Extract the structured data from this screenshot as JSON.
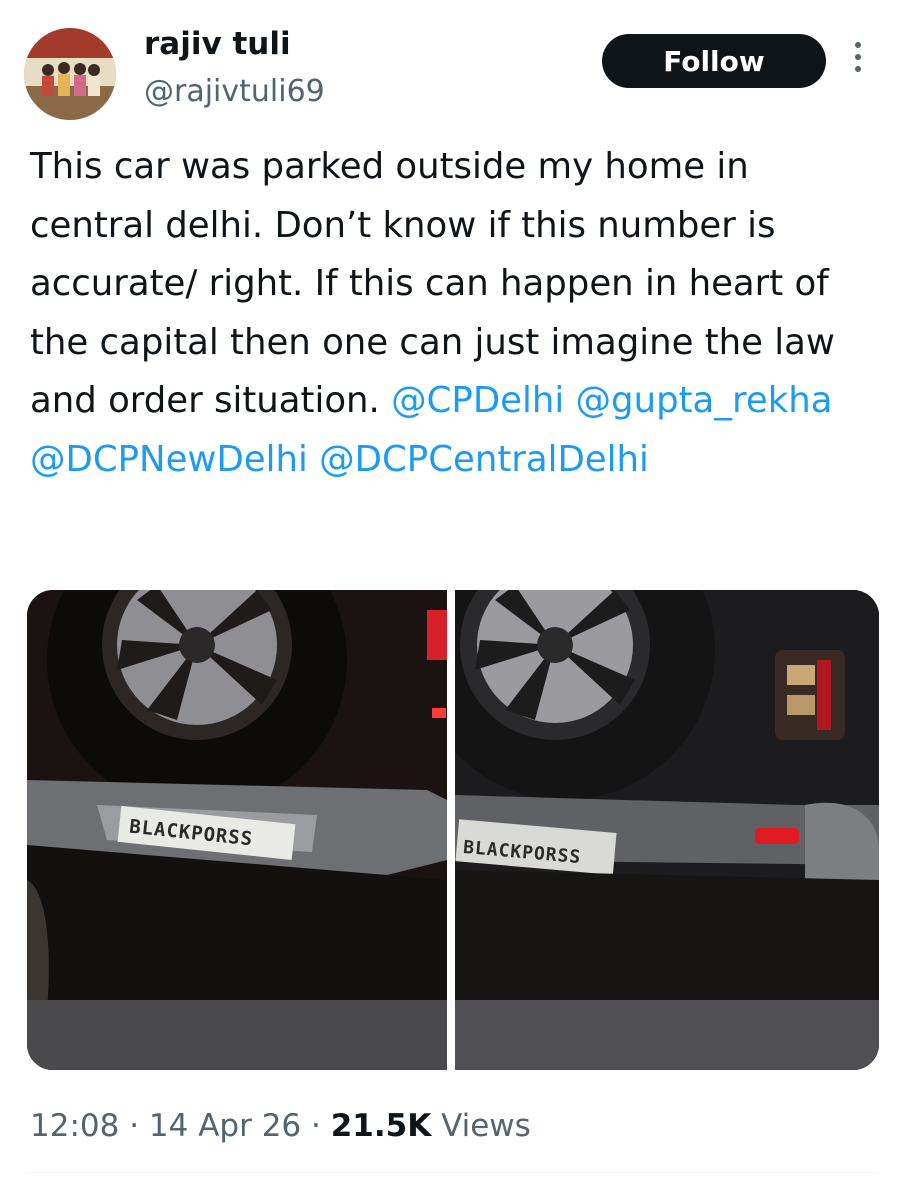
{
  "author": {
    "name": "rajiv tuli",
    "handle": "@rajivtuli69",
    "avatar_icon": "group-photo-avatar"
  },
  "follow_label": "Follow",
  "more_icon": "more-vertical-icon",
  "tweet": {
    "text": "This car was parked outside my home in central delhi. Don’t know if this number is accurate/ right. If this can happen in heart of the capital then one can just imagine the law and order situation.",
    "mentions": [
      "@CPDelhi",
      "@gupta_rekha",
      "@DCPNewDelhi",
      "@DCPCentralDelhi"
    ]
  },
  "media": {
    "photo_1_plate": "BLACKPORSS",
    "photo_2_plate": "BLACKPORSS"
  },
  "meta": {
    "time": "12:08",
    "date": "14 Apr 26",
    "views_count": "21.5K",
    "views_label": "Views"
  },
  "colors": {
    "link": "#1d9bf0",
    "text": "#0f1419",
    "secondary": "#536471",
    "button_bg": "#0f1419"
  }
}
